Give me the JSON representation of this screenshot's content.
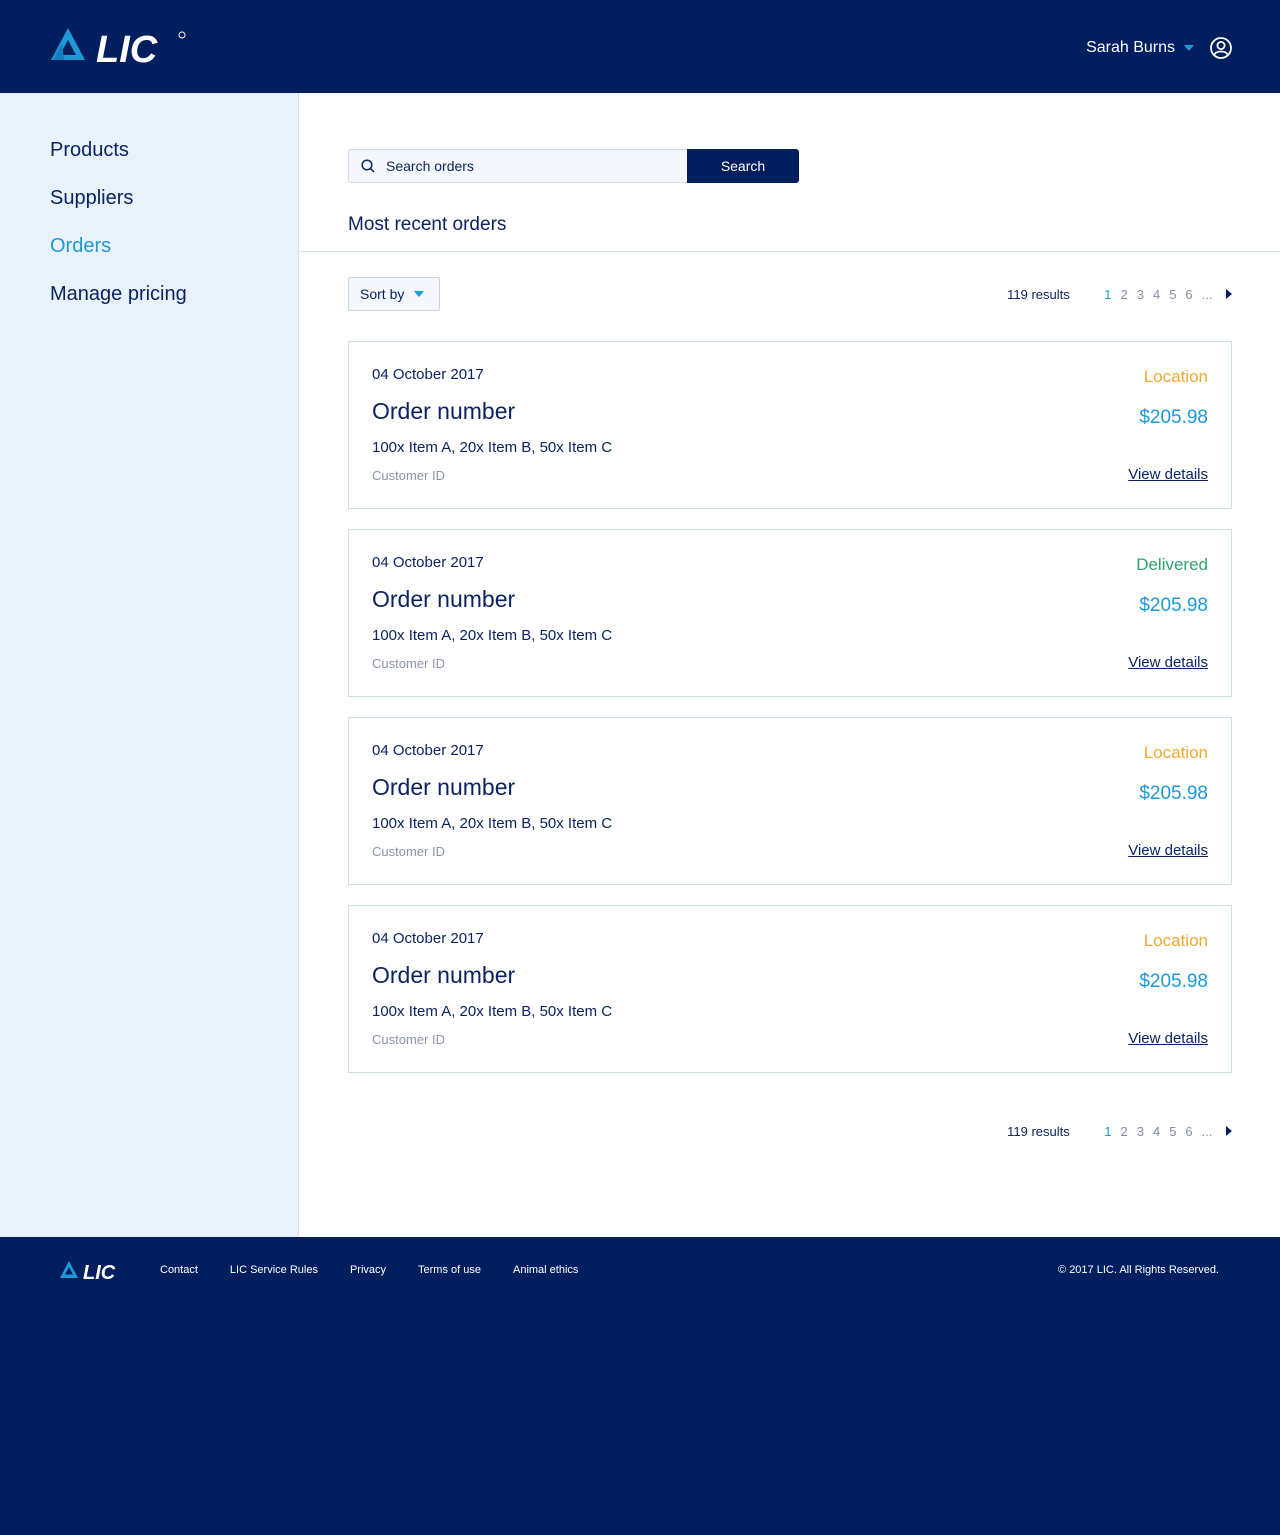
{
  "header": {
    "logo_text": "LIC",
    "user_name": "Sarah Burns"
  },
  "sidebar": {
    "items": [
      {
        "label": "Products"
      },
      {
        "label": "Suppliers"
      },
      {
        "label": "Orders"
      },
      {
        "label": "Manage pricing"
      }
    ],
    "active": "Orders"
  },
  "search": {
    "placeholder": "Search orders",
    "button_label": "Search"
  },
  "section_title": "Most recent orders",
  "sort_label": "Sort by",
  "pagination": {
    "results": "119 results",
    "pages": [
      "1",
      "2",
      "3",
      "4",
      "5",
      "6",
      "..."
    ],
    "current": "1"
  },
  "orders": [
    {
      "date": "04 October 2017",
      "title": "Order number",
      "items": "100x Item A, 20x Item B, 50x Item C",
      "customer": "Customer ID",
      "status": "Location",
      "price": "$205.98",
      "details_label": "View details"
    },
    {
      "date": "04 October 2017",
      "title": "Order number",
      "items": "100x Item A, 20x Item B, 50x Item C",
      "customer": "Customer ID",
      "status": "Delivered",
      "price": "$205.98",
      "details_label": "View details"
    },
    {
      "date": "04 October 2017",
      "title": "Order number",
      "items": "100x Item A, 20x Item B, 50x Item C",
      "customer": "Customer ID",
      "status": "Location",
      "price": "$205.98",
      "details_label": "View details"
    },
    {
      "date": "04 October 2017",
      "title": "Order number",
      "items": "100x Item A, 20x Item B, 50x Item C",
      "customer": "Customer ID",
      "status": "Location",
      "price": "$205.98",
      "details_label": "View details"
    }
  ],
  "footer": {
    "logo_text": "LIC",
    "links": [
      "Contact",
      "LIC Service Rules",
      "Privacy",
      "Terms of use",
      "Animal ethics"
    ],
    "copyright": "© 2017 LIC. All Rights Reserved."
  },
  "colors": {
    "navy": "#011e5f",
    "accent_blue": "#1b9ad6",
    "status_location": "#f0a833",
    "status_delivered": "#33a36b",
    "sidebar_bg": "#e9f1fa"
  },
  "icons": {
    "search": "search-icon",
    "user": "user-account-icon",
    "dropdown": "chevron-down-icon",
    "next": "next-page-icon",
    "logo": "lic-logo"
  }
}
